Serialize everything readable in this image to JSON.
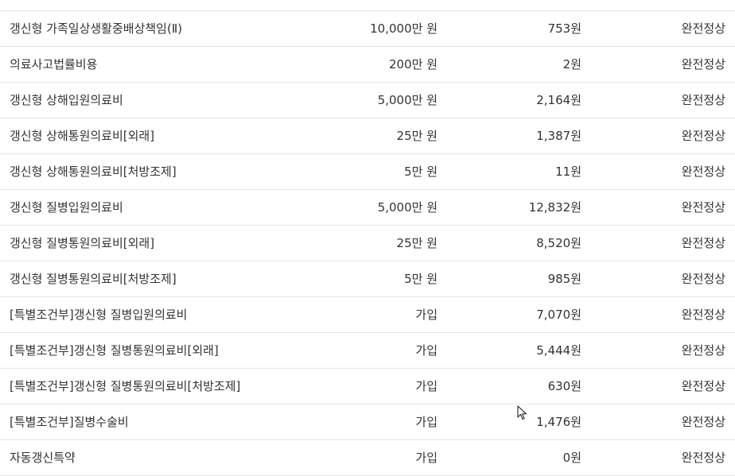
{
  "coverage_table": {
    "rows": [
      {
        "name": "",
        "amount": "",
        "premium": "",
        "status": ""
      },
      {
        "name": "갱신형 가족일상생활중배상책임(Ⅱ)",
        "amount": "10,000만 원",
        "premium": "753원",
        "status": "완전정상"
      },
      {
        "name": "의료사고법률비용",
        "amount": "200만 원",
        "premium": "2원",
        "status": "완전정상"
      },
      {
        "name": "갱신형 상해입원의료비",
        "amount": "5,000만 원",
        "premium": "2,164원",
        "status": "완전정상"
      },
      {
        "name": "갱신형 상해통원의료비[외래]",
        "amount": "25만 원",
        "premium": "1,387원",
        "status": "완전정상"
      },
      {
        "name": "갱신형 상해통원의료비[처방조제]",
        "amount": "5만 원",
        "premium": "11원",
        "status": "완전정상"
      },
      {
        "name": "갱신형 질병입원의료비",
        "amount": "5,000만 원",
        "premium": "12,832원",
        "status": "완전정상"
      },
      {
        "name": "갱신형 질병통원의료비[외래]",
        "amount": "25만 원",
        "premium": "8,520원",
        "status": "완전정상"
      },
      {
        "name": "갱신형 질병통원의료비[처방조제]",
        "amount": "5만 원",
        "premium": "985원",
        "status": "완전정상"
      },
      {
        "name": "[특별조건부]갱신형 질병입원의료비",
        "amount": "가입",
        "premium": "7,070원",
        "status": "완전정상"
      },
      {
        "name": "[특별조건부]갱신형 질병통원의료비[외래]",
        "amount": "가입",
        "premium": "5,444원",
        "status": "완전정상"
      },
      {
        "name": "[특별조건부]갱신형 질병통원의료비[처방조제]",
        "amount": "가입",
        "premium": "630원",
        "status": "완전정상"
      },
      {
        "name": "[특별조건부]질병수술비",
        "amount": "가입",
        "premium": "1,476원",
        "status": "완전정상"
      },
      {
        "name": "자동갱신특약",
        "amount": "가입",
        "premium": "0원",
        "status": "완전정상"
      }
    ]
  },
  "cursor": {
    "icon": "mouse-pointer-icon"
  }
}
